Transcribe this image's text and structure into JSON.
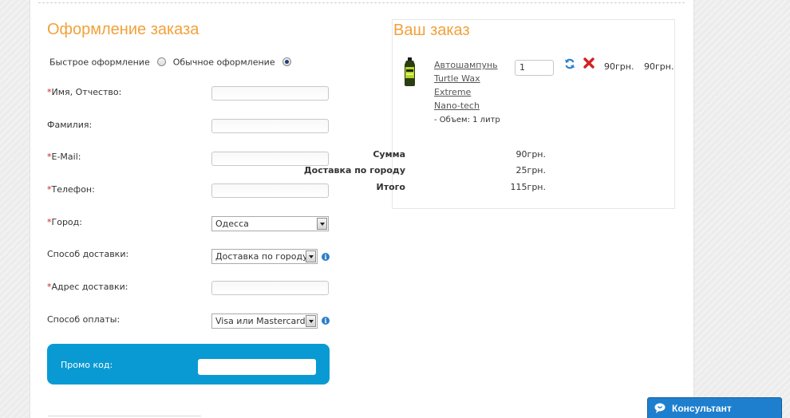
{
  "checkout": {
    "title": "Оформление заказа",
    "type_options": [
      "Быстрое оформление",
      "Обычное оформление"
    ],
    "selected_type": "Обычное оформление"
  },
  "form": {
    "name_label": "Имя, Отчество:",
    "surname_label": "Фамилия:",
    "email_label": "E-Mail:",
    "phone_label": "Телефон:",
    "city_label": "Город:",
    "city_value": "Одесса",
    "delivery_label": "Способ доставки:",
    "delivery_value": "Доставка по городу",
    "address_label": "Адрес доставки:",
    "payment_label": "Способ оплаты:",
    "payment_value": "Visa или Mastercard(L",
    "required_mark": "*",
    "promo_label": "Промо код:"
  },
  "order": {
    "title": "Ваш заказ",
    "item": {
      "name": "Автошампунь Turtle Wax Extreme Nano-tech",
      "option": "- Объем: 1 литр",
      "quantity": "1",
      "unit_price": "90грн.",
      "total_price": "90грн."
    },
    "totals": [
      {
        "label": "Сумма",
        "value": "90грн."
      },
      {
        "label": "Доставка по городу",
        "value": "25грн."
      },
      {
        "label": "Итого",
        "value": "115грн."
      }
    ]
  },
  "consultant": {
    "label": "Консультант"
  },
  "colors": {
    "accent": "#f2a13a",
    "promo_bg": "#0a9ad3",
    "required": "#d02020",
    "consultant_bg": "#1e7fcf"
  }
}
